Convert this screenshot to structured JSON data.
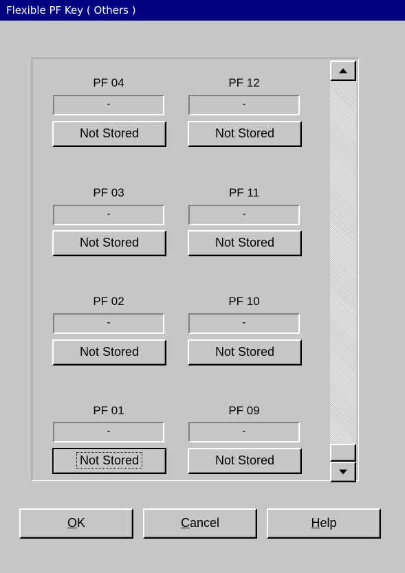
{
  "window": {
    "title": "Flexible PF Key ( Others )"
  },
  "keys": [
    {
      "label": "PF 04",
      "value": "-",
      "button": "Not Stored"
    },
    {
      "label": "PF 12",
      "value": "-",
      "button": "Not Stored"
    },
    {
      "label": "PF 03",
      "value": "-",
      "button": "Not Stored"
    },
    {
      "label": "PF 11",
      "value": "-",
      "button": "Not Stored"
    },
    {
      "label": "PF 02",
      "value": "-",
      "button": "Not Stored"
    },
    {
      "label": "PF 10",
      "value": "-",
      "button": "Not Stored"
    },
    {
      "label": "PF 01",
      "value": "-",
      "button": "Not Stored"
    },
    {
      "label": "PF 09",
      "value": "-",
      "button": "Not Stored"
    }
  ],
  "dialog_buttons": {
    "ok": {
      "mnemonic": "O",
      "rest": "K"
    },
    "cancel": {
      "mnemonic": "C",
      "rest": "ancel"
    },
    "help": {
      "mnemonic": "H",
      "rest": "elp"
    }
  },
  "scrollbar": {
    "position": 1.0
  },
  "icons": {
    "scroll_up": "arrow-up-icon",
    "scroll_down": "arrow-down-icon"
  }
}
